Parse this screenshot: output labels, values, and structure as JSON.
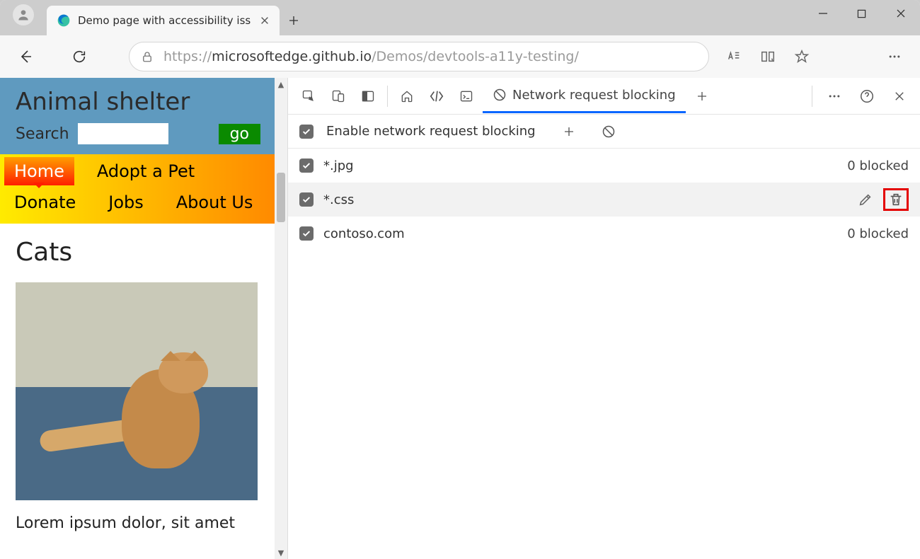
{
  "tab": {
    "title": "Demo page with accessibility issu"
  },
  "url": {
    "prefix": "https://",
    "host": "microsoftedge.github.io",
    "path": "/Demos/devtools-a11y-testing/"
  },
  "page": {
    "site_title": "Animal shelter",
    "search_label": "Search",
    "go_label": "go",
    "nav": {
      "home": "Home",
      "adopt": "Adopt a Pet",
      "donate": "Donate",
      "jobs": "Jobs",
      "about": "About Us"
    },
    "h2": "Cats",
    "paragraph": "Lorem ipsum dolor, sit amet"
  },
  "devtools": {
    "active_tab_label": "Network request blocking",
    "enable_label": "Enable network request blocking",
    "patterns": [
      {
        "pattern": "*.jpg",
        "blocked": "0 blocked"
      },
      {
        "pattern": "*.css",
        "blocked": ""
      },
      {
        "pattern": "contoso.com",
        "blocked": "0 blocked"
      }
    ]
  }
}
